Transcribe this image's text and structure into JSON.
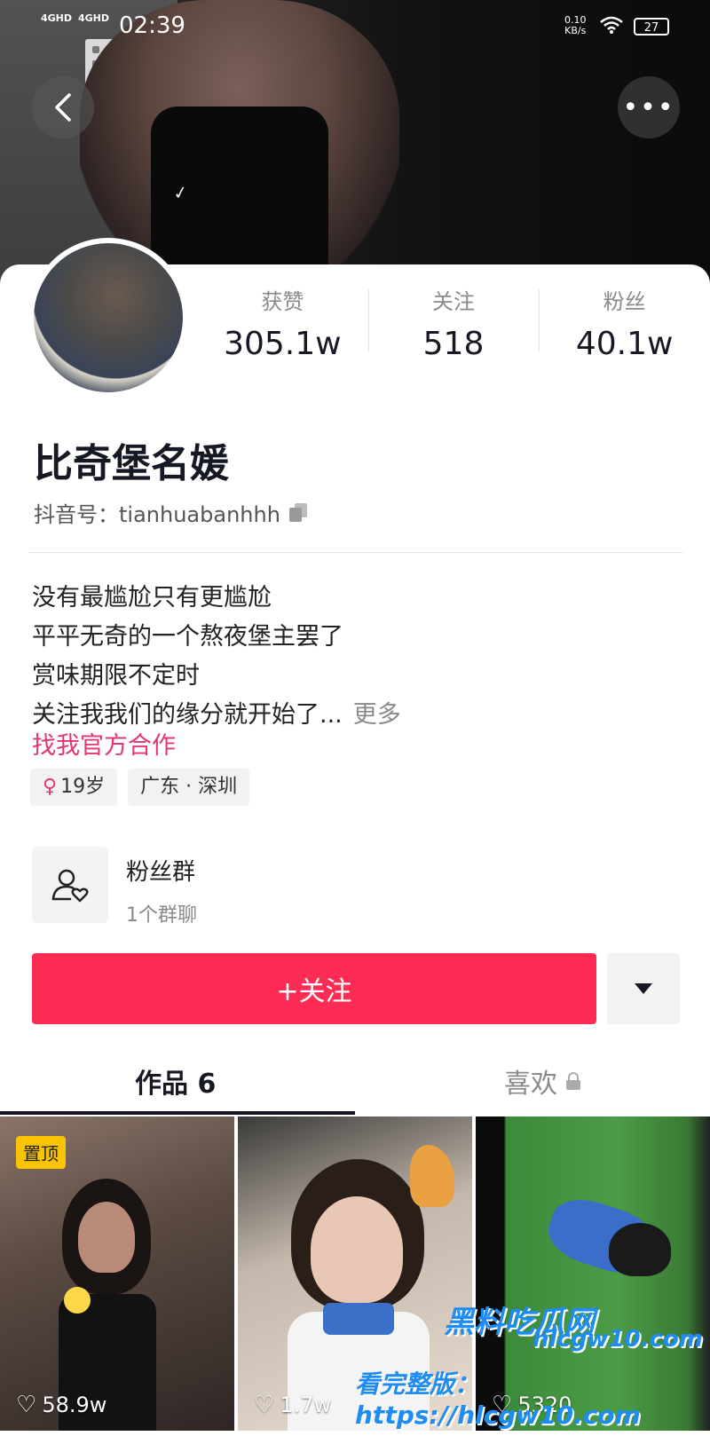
{
  "status_bar": {
    "signal_1": "4GHD",
    "signal_2": "4GHD",
    "time": "02:39",
    "net_speed": "0.10",
    "net_unit": "KB/s",
    "battery": "27"
  },
  "profile": {
    "stats": [
      {
        "label": "获赞",
        "value": "305.1w"
      },
      {
        "label": "关注",
        "value": "518"
      },
      {
        "label": "粉丝",
        "value": "40.1w"
      }
    ],
    "name": "比奇堡名媛",
    "handle_label": "抖音号：",
    "handle": "tianhuabanhhh",
    "bio_lines": [
      "没有最尴尬只有更尴尬",
      "平平无奇的一个熬夜堡主罢了",
      "赏味期限不定时",
      "关注我我们的缘分就开始了..."
    ],
    "bio_more": "更多",
    "collab_link": "找我官方合作",
    "tags": {
      "age": "19岁",
      "location": "广东 · 深圳"
    },
    "fan_group": {
      "title": "粉丝群",
      "subtitle": "1个群聊"
    },
    "follow_label": "+关注"
  },
  "tabs": {
    "works": "作品 6",
    "likes": "喜欢"
  },
  "videos": [
    {
      "badge": "置顶",
      "likes": "58.9w"
    },
    {
      "likes": "1.7w"
    },
    {
      "likes": "5320"
    }
  ],
  "watermark": {
    "brand": "黑料吃瓜网",
    "domain": "hlcgw10.com",
    "full_version": "看完整版：https://hlcgw10.com"
  },
  "colors": {
    "accent": "#fe2c55",
    "link": "#e3386d",
    "pinned_badge": "#fac400",
    "watermark": "#1e8cf2"
  }
}
